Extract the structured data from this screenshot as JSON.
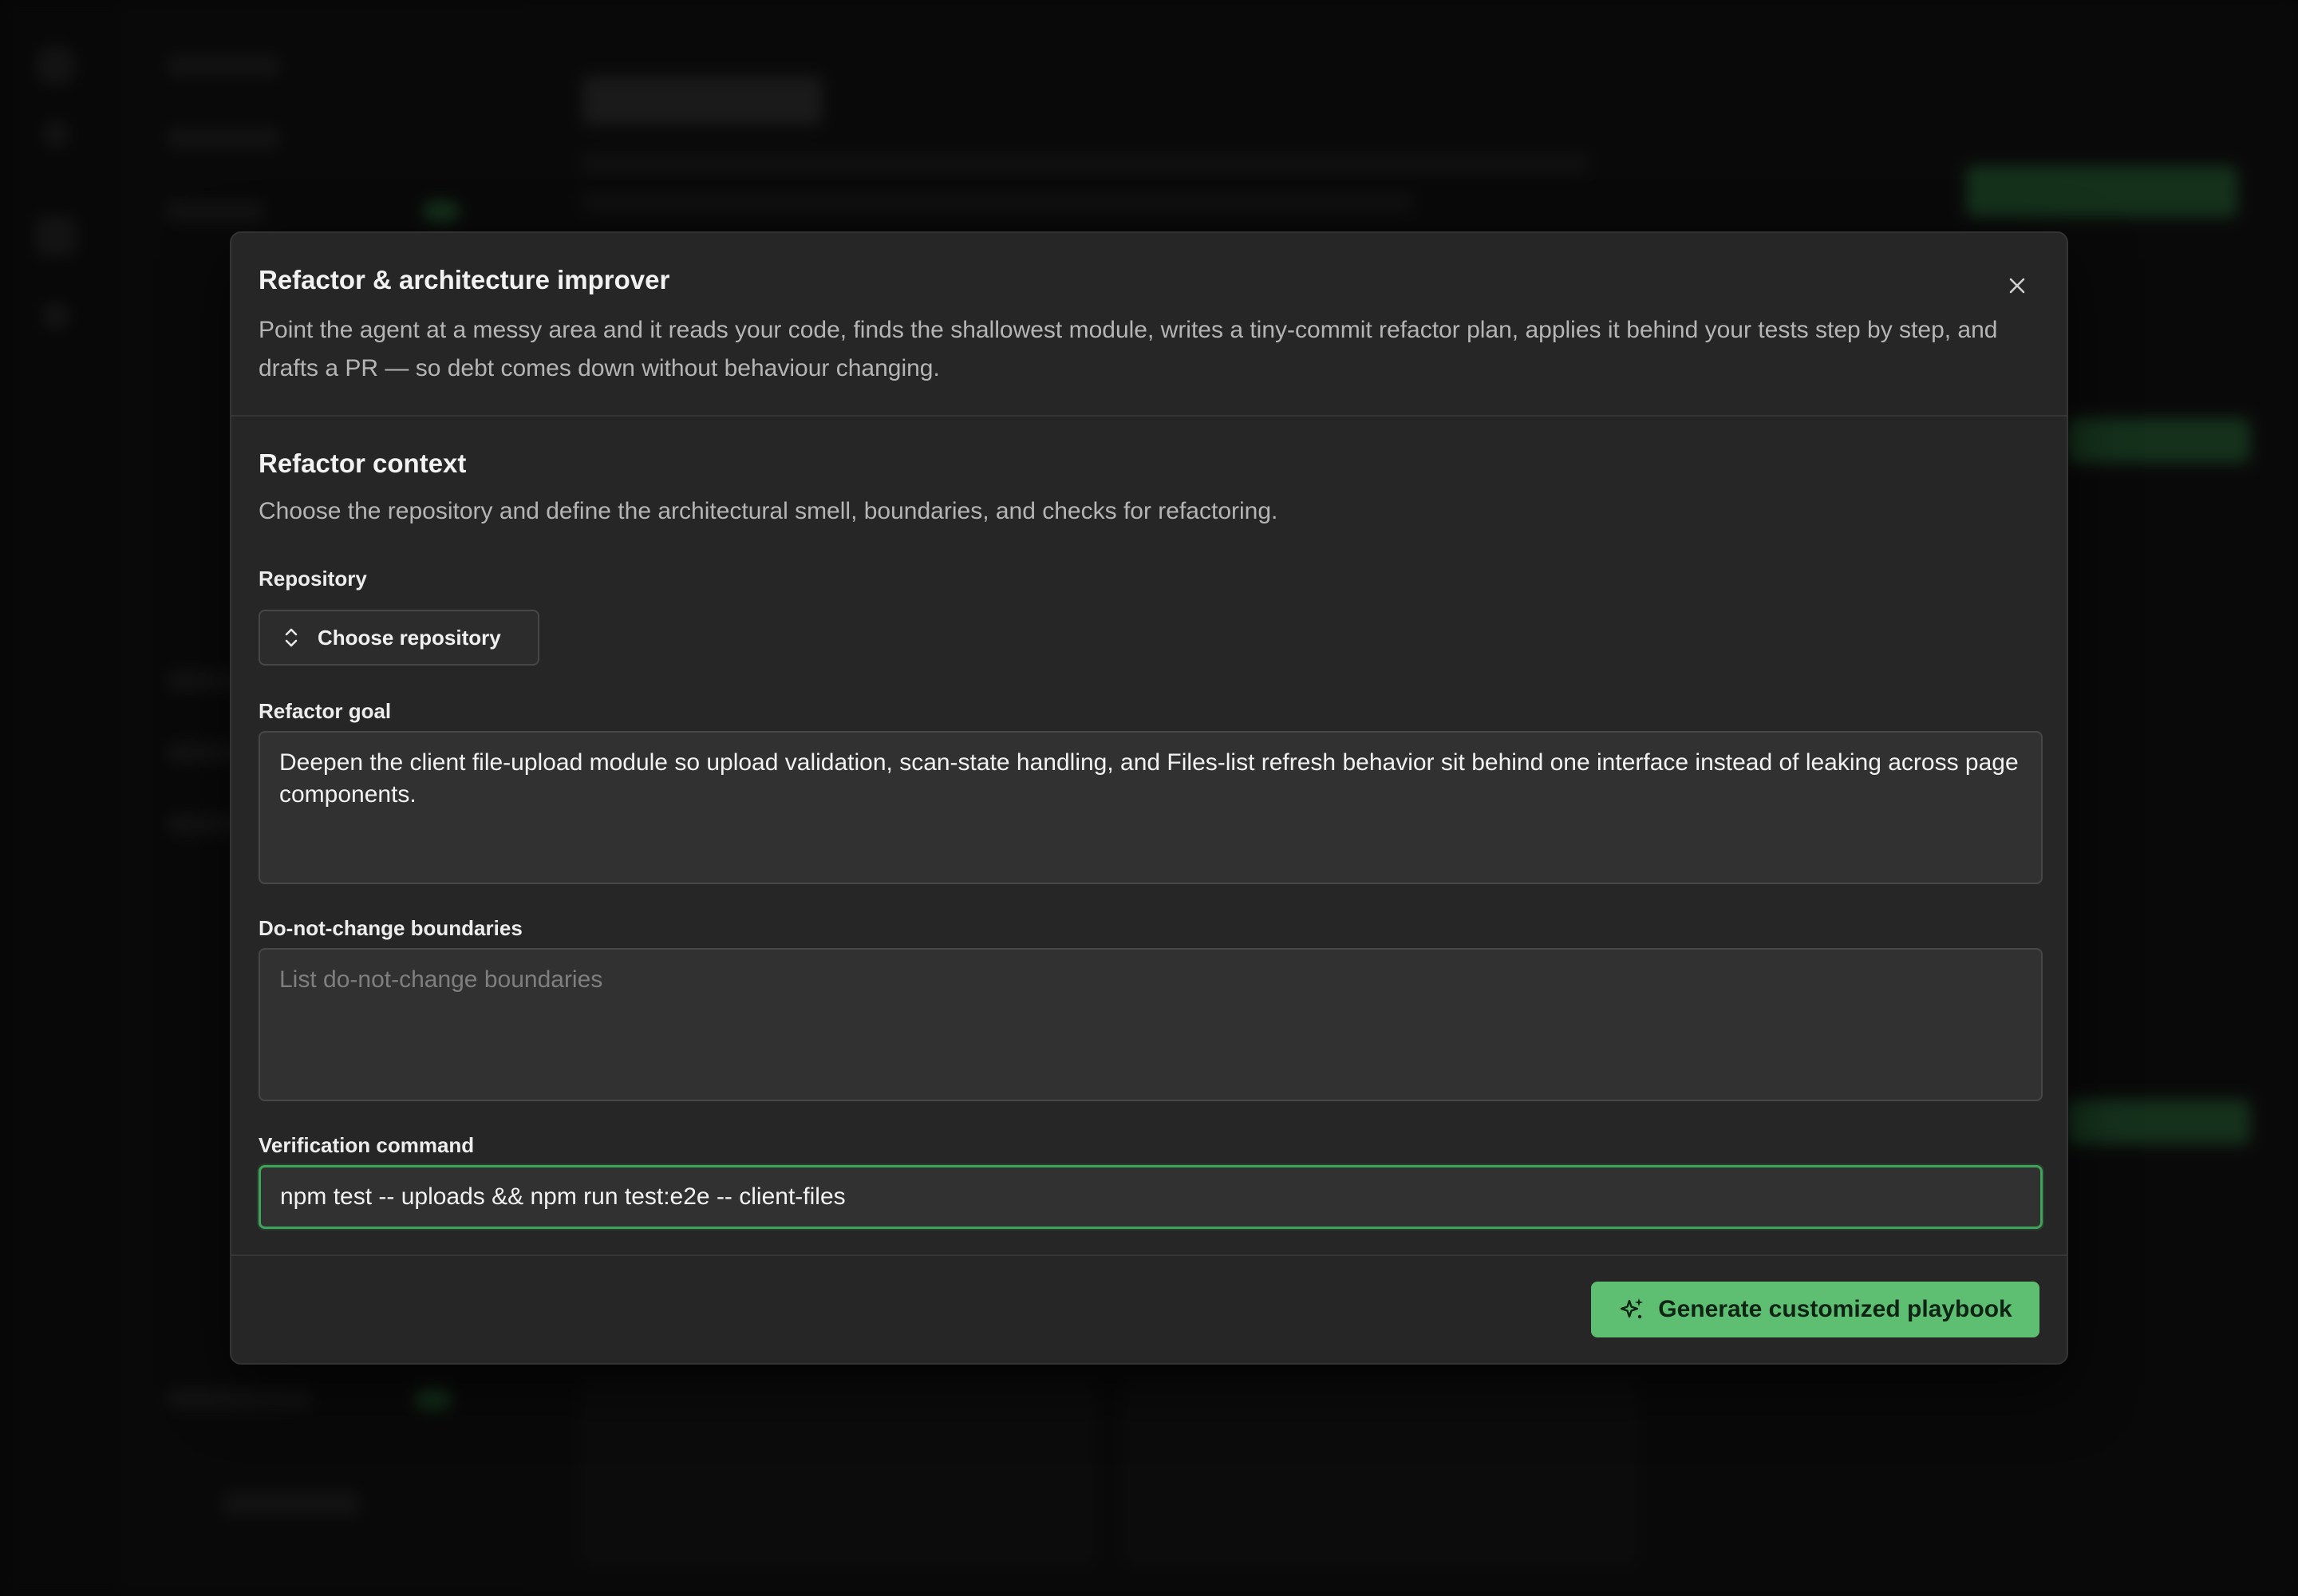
{
  "modal": {
    "title": "Refactor & architecture improver",
    "description": "Point the agent at a messy area and it reads your code, finds the shallowest module, writes a tiny-commit refactor plan, applies it behind your tests step by step, and drafts a PR — so debt comes down without behaviour changing.",
    "close_icon": "close-icon"
  },
  "section": {
    "title": "Refactor context",
    "description": "Choose the repository and define the architectural smell, boundaries, and checks for refactoring."
  },
  "repository": {
    "label": "Repository",
    "button_label": "Choose repository",
    "icon": "chevron-up-down-icon"
  },
  "refactor_goal": {
    "label": "Refactor goal",
    "value": "Deepen the client file-upload module so upload validation, scan-state handling, and Files-list refresh behavior sit behind one interface instead of leaking across page components."
  },
  "boundaries": {
    "label": "Do-not-change boundaries",
    "placeholder": "List do-not-change boundaries",
    "value": ""
  },
  "verification": {
    "label": "Verification command",
    "value": "npm test -- uploads && npm run test:e2e -- client-files"
  },
  "generate": {
    "label": "Generate customized playbook",
    "icon": "sparkles-icon"
  },
  "colors": {
    "accent": "#5ebf72",
    "focus_border": "#3fa35a",
    "modal_bg": "#262626"
  }
}
